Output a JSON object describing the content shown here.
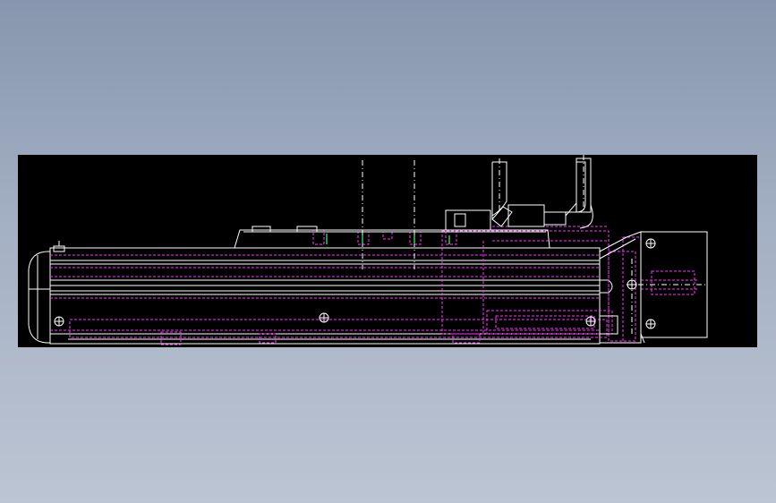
{
  "viewer": {
    "background_color": "#8c9ab1",
    "canvas_color": "#000000"
  },
  "drawing": {
    "subject": "",
    "colors": {
      "outline": "#ffffff",
      "hidden_lines": "#ff33ff",
      "center_lines": "#ffffff",
      "accent": "#33ff66"
    },
    "icons": [
      "screw-head-icon",
      "screw-head-icon",
      "screw-head-icon",
      "screw-head-icon",
      "screw-head-icon",
      "screw-head-icon"
    ]
  }
}
